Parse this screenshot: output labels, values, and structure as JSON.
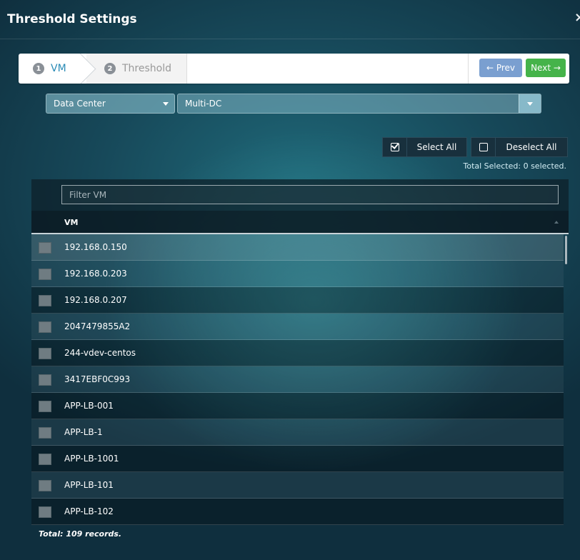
{
  "dialog": {
    "title": "Threshold Settings",
    "close_symbol": "×"
  },
  "wizard": {
    "steps": [
      {
        "number": "1",
        "label": "VM"
      },
      {
        "number": "2",
        "label": "Threshold"
      }
    ],
    "prev_label": "← Prev",
    "next_label": "Next →"
  },
  "filters": {
    "scope_selected": "Data Center",
    "value_selected": "Multi-DC"
  },
  "selection": {
    "select_all_label": "Select All",
    "deselect_all_label": "Deselect All",
    "total_selected": "Total Selected: 0 selected."
  },
  "grid": {
    "filter_placeholder": "Filter VM",
    "column_header": "VM",
    "rows": [
      "192.168.0.150",
      "192.168.0.203",
      "192.168.0.207",
      "2047479855A2",
      "244-vdev-centos",
      "3417EBF0C993",
      "APP-LB-001",
      "APP-LB-1",
      "APP-LB-1001",
      "APP-LB-101",
      "APP-LB-102"
    ],
    "total_records": "Total: 109 records."
  },
  "colors": {
    "accent_blue": "#2a8bb6",
    "prev_button": "#7a9fd0",
    "next_button": "#45b34a"
  }
}
